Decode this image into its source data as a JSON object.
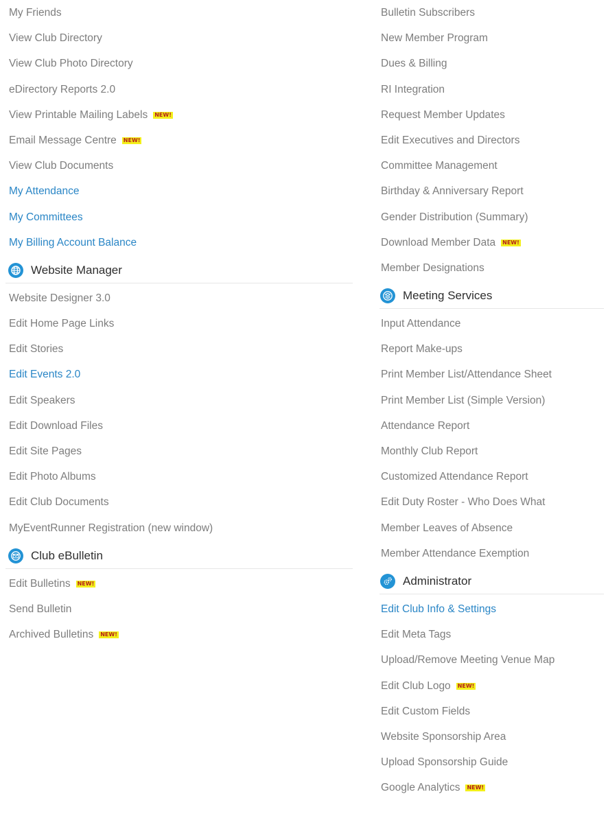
{
  "new_badge": "NEW!",
  "colors": {
    "link": "#7d7d7d",
    "link_active": "#2a86c6",
    "icon_bg": "#2393d5",
    "badge_bg": "#f3ef1a",
    "badge_text": "#b4201a"
  },
  "left": {
    "member_links": [
      {
        "label": "My Friends"
      },
      {
        "label": "View Club Directory"
      },
      {
        "label": "View Club Photo Directory"
      },
      {
        "label": "eDirectory Reports 2.0"
      },
      {
        "label": "View Printable Mailing Labels",
        "is_new": true
      },
      {
        "label": "Email Message Centre",
        "is_new": true
      },
      {
        "label": "View Club Documents"
      },
      {
        "label": "My Attendance",
        "blue": true
      },
      {
        "label": "My Committees",
        "blue": true
      },
      {
        "label": "My Billing Account Balance",
        "blue": true
      }
    ],
    "website_manager": {
      "title": "Website Manager",
      "icon": "globe-icon",
      "links": [
        {
          "label": "Website Designer 3.0"
        },
        {
          "label": "Edit Home Page Links"
        },
        {
          "label": "Edit Stories"
        },
        {
          "label": "Edit Events 2.0",
          "blue": true
        },
        {
          "label": "Edit Speakers"
        },
        {
          "label": "Edit Download Files"
        },
        {
          "label": "Edit Site Pages"
        },
        {
          "label": "Edit Photo Albums"
        },
        {
          "label": "Edit Club Documents"
        },
        {
          "label": "MyEventRunner Registration (new window)"
        }
      ]
    },
    "club_ebulletin": {
      "title": "Club eBulletin",
      "icon": "envelope-icon",
      "links": [
        {
          "label": "Edit Bulletins",
          "is_new": true
        },
        {
          "label": "Send Bulletin"
        },
        {
          "label": "Archived Bulletins",
          "is_new": true
        }
      ]
    }
  },
  "right": {
    "member_links": [
      {
        "label": "Bulletin Subscribers"
      },
      {
        "label": "New Member Program"
      },
      {
        "label": "Dues & Billing"
      },
      {
        "label": "RI Integration"
      },
      {
        "label": "Request Member Updates"
      },
      {
        "label": "Edit Executives and Directors"
      },
      {
        "label": "Committee Management"
      },
      {
        "label": "Birthday & Anniversary Report"
      },
      {
        "label": "Gender Distribution (Summary)"
      },
      {
        "label": "Download Member Data",
        "is_new": true
      },
      {
        "label": "Member Designations"
      }
    ],
    "meeting_services": {
      "title": "Meeting Services",
      "icon": "stack-icon",
      "links": [
        {
          "label": "Input Attendance"
        },
        {
          "label": "Report Make-ups"
        },
        {
          "label": "Print Member List/Attendance Sheet"
        },
        {
          "label": "Print Member List (Simple Version)"
        },
        {
          "label": "Attendance Report"
        },
        {
          "label": "Monthly Club Report"
        },
        {
          "label": "Customized Attendance Report"
        },
        {
          "label": "Edit Duty Roster - Who Does What"
        },
        {
          "label": "Member Leaves of Absence"
        },
        {
          "label": "Member Attendance Exemption"
        }
      ]
    },
    "administrator": {
      "title": "Administrator",
      "icon": "gears-icon",
      "links": [
        {
          "label": "Edit Club Info & Settings",
          "blue": true
        },
        {
          "label": "Edit Meta Tags"
        },
        {
          "label": "Upload/Remove Meeting Venue Map"
        },
        {
          "label": "Edit Club Logo",
          "is_new": true
        },
        {
          "label": "Edit Custom Fields"
        },
        {
          "label": "Website Sponsorship Area"
        },
        {
          "label": "Upload Sponsorship Guide"
        },
        {
          "label": "Google Analytics",
          "is_new": true
        }
      ]
    }
  }
}
